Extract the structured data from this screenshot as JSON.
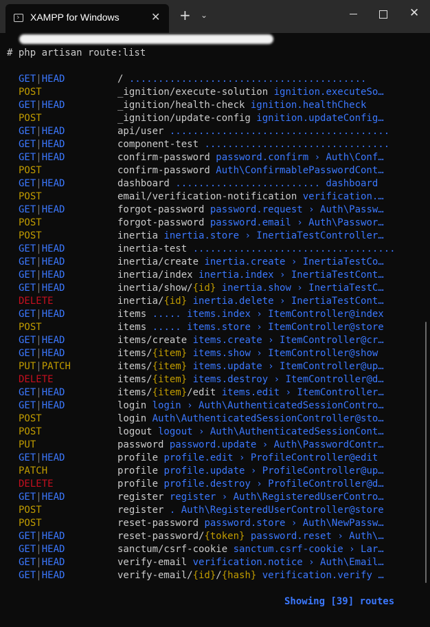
{
  "window": {
    "tab_title": "XAMPP for Windows",
    "tab_close": "✕",
    "new_tab": "+",
    "dropdown": "⌄",
    "close": "✕"
  },
  "terminal": {
    "command": "# php artisan route:list",
    "footer": "Showing [39] routes",
    "colors": {
      "get": "#3b78ff",
      "post": "#c19c00",
      "delete": "#c50f1f",
      "sep": "#767676",
      "text": "#cccccc"
    },
    "routes": [
      {
        "method": "GET|HEAD",
        "uri": "/",
        "rest": " ........................................."
      },
      {
        "method": "POST",
        "uri": "_ignition/execute-solution",
        "rest": " ignition.executeSo…"
      },
      {
        "method": "GET|HEAD",
        "uri": "_ignition/health-check",
        "rest": " ignition.healthCheck"
      },
      {
        "method": "POST",
        "uri": "_ignition/update-config",
        "rest": " ignition.updateConfig…"
      },
      {
        "method": "GET|HEAD",
        "uri": "api/user",
        "rest": " ......................................"
      },
      {
        "method": "GET|HEAD",
        "uri": "component-test",
        "rest": " ................................"
      },
      {
        "method": "GET|HEAD",
        "uri": "confirm-password",
        "rest": " password.confirm › Auth\\Conf…"
      },
      {
        "method": "POST",
        "uri": "confirm-password",
        "rest": " Auth\\ConfirmablePasswordCont…"
      },
      {
        "method": "GET|HEAD",
        "uri": "dashboard",
        "rest": " ......................... dashboard"
      },
      {
        "method": "POST",
        "uri": "email/verification-notification",
        "rest": " verification.…"
      },
      {
        "method": "GET|HEAD",
        "uri": "forgot-password",
        "rest": " password.request › Auth\\Passw…"
      },
      {
        "method": "POST",
        "uri": "forgot-password",
        "rest": " password.email › Auth\\Passwor…"
      },
      {
        "method": "POST",
        "uri": "inertia",
        "rest": " inertia.store › InertiaTestController…"
      },
      {
        "method": "GET|HEAD",
        "uri": "inertia-test",
        "rest": " ..................................."
      },
      {
        "method": "GET|HEAD",
        "uri": "inertia/create",
        "rest": " inertia.create › InertiaTestCo…"
      },
      {
        "method": "GET|HEAD",
        "uri": "inertia/index",
        "rest": " inertia.index › InertiaTestCont…"
      },
      {
        "method": "GET|HEAD",
        "uri": "inertia/show/",
        "param": "{id}",
        "rest": " inertia.show › InertiaTestC…"
      },
      {
        "method": "DELETE",
        "uri": "inertia/",
        "param": "{id}",
        "rest": " inertia.delete › InertiaTestCont…"
      },
      {
        "method": "GET|HEAD",
        "uri": "items",
        "rest": " ..... items.index › ItemController@index"
      },
      {
        "method": "POST",
        "uri": "items",
        "rest": " ..... items.store › ItemController@store"
      },
      {
        "method": "GET|HEAD",
        "uri": "items/create",
        "rest": " items.create › ItemController@cr…"
      },
      {
        "method": "GET|HEAD",
        "uri": "items/",
        "param": "{item}",
        "rest": " items.show › ItemController@show"
      },
      {
        "method": "PUT|PATCH",
        "uri": "items/",
        "param": "{item}",
        "rest": " items.update › ItemController@up…"
      },
      {
        "method": "DELETE",
        "uri": "items/",
        "param": "{item}",
        "rest": " items.destroy › ItemController@d…"
      },
      {
        "method": "GET|HEAD",
        "uri": "items/",
        "param": "{item}",
        "suffix": "/edit",
        "rest": " items.edit › ItemController…"
      },
      {
        "method": "GET|HEAD",
        "uri": "login",
        "rest": " login › Auth\\AuthenticatedSessionContro…"
      },
      {
        "method": "POST",
        "uri": "login",
        "rest": " Auth\\AuthenticatedSessionController@sto…"
      },
      {
        "method": "POST",
        "uri": "logout",
        "rest": " logout › Auth\\AuthenticatedSessionCont…"
      },
      {
        "method": "PUT",
        "uri": "password",
        "rest": " password.update › Auth\\PasswordContr…"
      },
      {
        "method": "GET|HEAD",
        "uri": "profile",
        "rest": " profile.edit › ProfileController@edit"
      },
      {
        "method": "PATCH",
        "uri": "profile",
        "rest": " profile.update › ProfileController@up…"
      },
      {
        "method": "DELETE",
        "uri": "profile",
        "rest": " profile.destroy › ProfileController@d…"
      },
      {
        "method": "GET|HEAD",
        "uri": "register",
        "rest": " register › Auth\\RegisteredUserContro…"
      },
      {
        "method": "POST",
        "uri": "register",
        "rest": " . Auth\\RegisteredUserController@store"
      },
      {
        "method": "POST",
        "uri": "reset-password",
        "rest": " password.store › Auth\\NewPassw…"
      },
      {
        "method": "GET|HEAD",
        "uri": "reset-password/",
        "param": "{token}",
        "rest": " password.reset › Auth\\…"
      },
      {
        "method": "GET|HEAD",
        "uri": "sanctum/csrf-cookie",
        "rest": " sanctum.csrf-cookie › Lar…"
      },
      {
        "method": "GET|HEAD",
        "uri": "verify-email",
        "rest": " verification.notice › Auth\\Email…"
      },
      {
        "method": "GET|HEAD",
        "uri": "verify-email/",
        "param": "{id}",
        "suffix": "/",
        "param2": "{hash}",
        "rest": " verification.verify …"
      }
    ]
  }
}
